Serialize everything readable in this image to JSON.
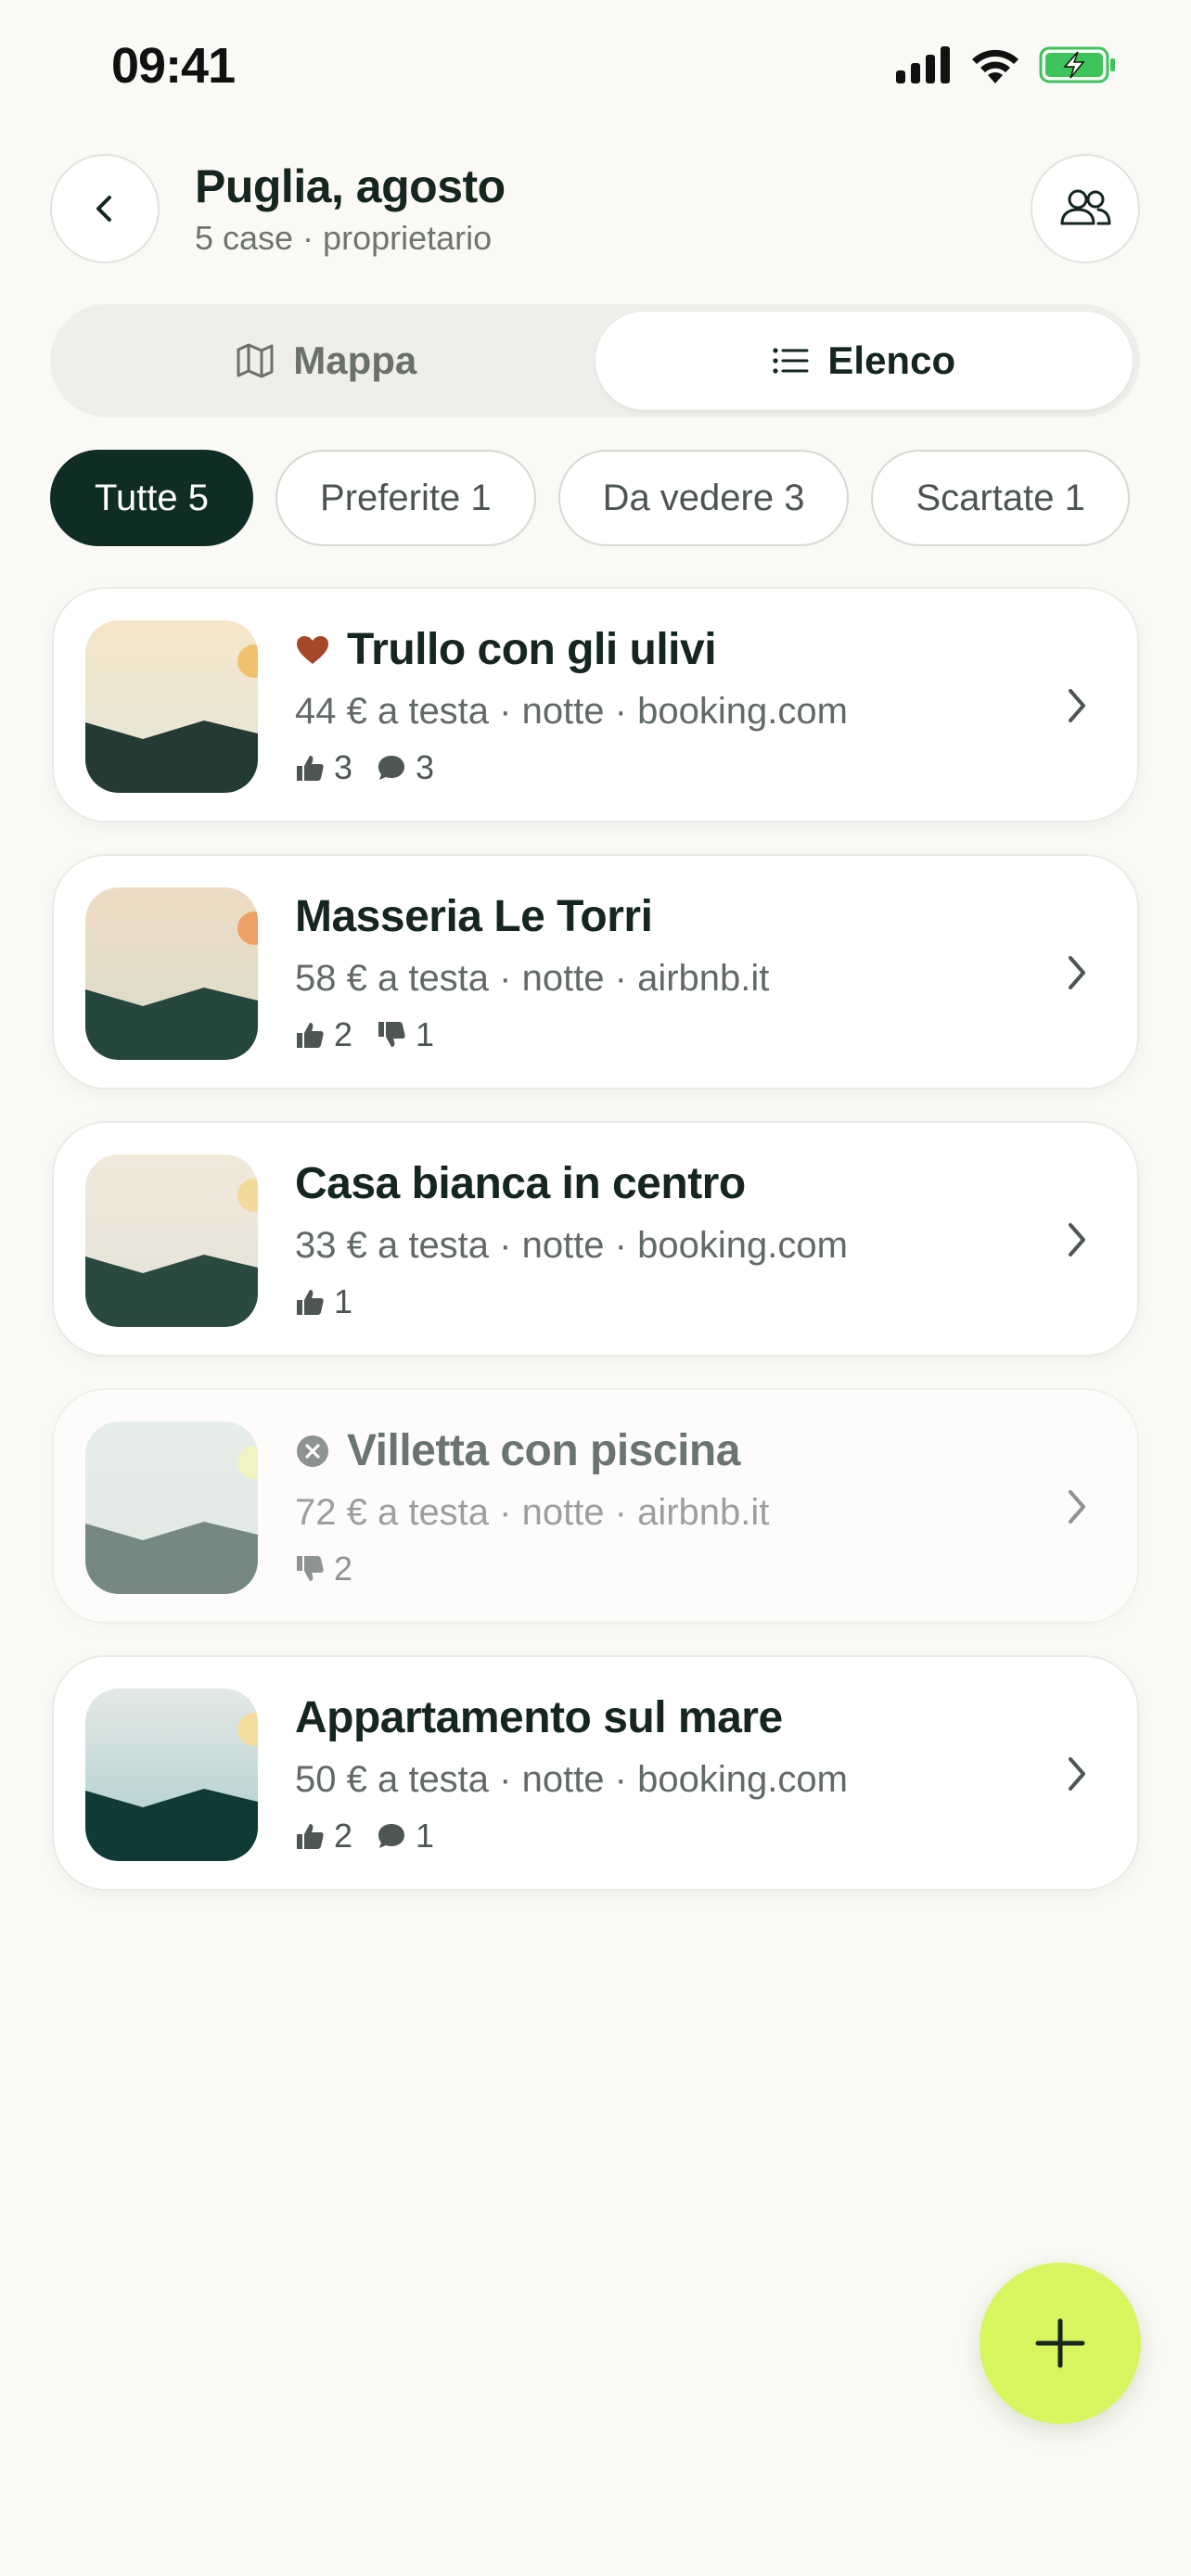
{
  "status_bar": {
    "time": "09:41"
  },
  "header": {
    "title": "Puglia, agosto",
    "subtitle": "5 case · proprietario"
  },
  "view_toggle": {
    "map_label": "Mappa",
    "list_label": "Elenco",
    "active": "list"
  },
  "filters": [
    {
      "label": "Tutte 5",
      "active": true
    },
    {
      "label": "Preferite 1",
      "active": false
    },
    {
      "label": "Da vedere 3",
      "active": false
    },
    {
      "label": "Scartate 1",
      "active": false
    }
  ],
  "listings": [
    {
      "title": "Trullo con gli ulivi",
      "meta": "44 € a testa · notte · booking.com",
      "status": "favorite",
      "likes": "3",
      "comments": "3",
      "dislikes": null
    },
    {
      "title": "Masseria Le Torri",
      "meta": "58 € a testa · notte · airbnb.it",
      "status": "to-see",
      "likes": "2",
      "comments": null,
      "dislikes": "1"
    },
    {
      "title": "Casa bianca in centro",
      "meta": "33 € a testa · notte · booking.com",
      "status": "to-see",
      "likes": "1",
      "comments": null,
      "dislikes": null
    },
    {
      "title": "Villetta con piscina",
      "meta": "72 € a testa · notte · airbnb.it",
      "status": "discarded",
      "likes": null,
      "comments": null,
      "dislikes": "2"
    },
    {
      "title": "Appartamento sul mare",
      "meta": "50 € a testa · notte · booking.com",
      "status": "to-see",
      "likes": "2",
      "comments": "1",
      "dislikes": null
    }
  ],
  "colors": {
    "accent_dark": "#0F2C25",
    "fab": "#D7F55E",
    "favorite_heart": "#A5482A",
    "battery": "#3DC45A"
  }
}
